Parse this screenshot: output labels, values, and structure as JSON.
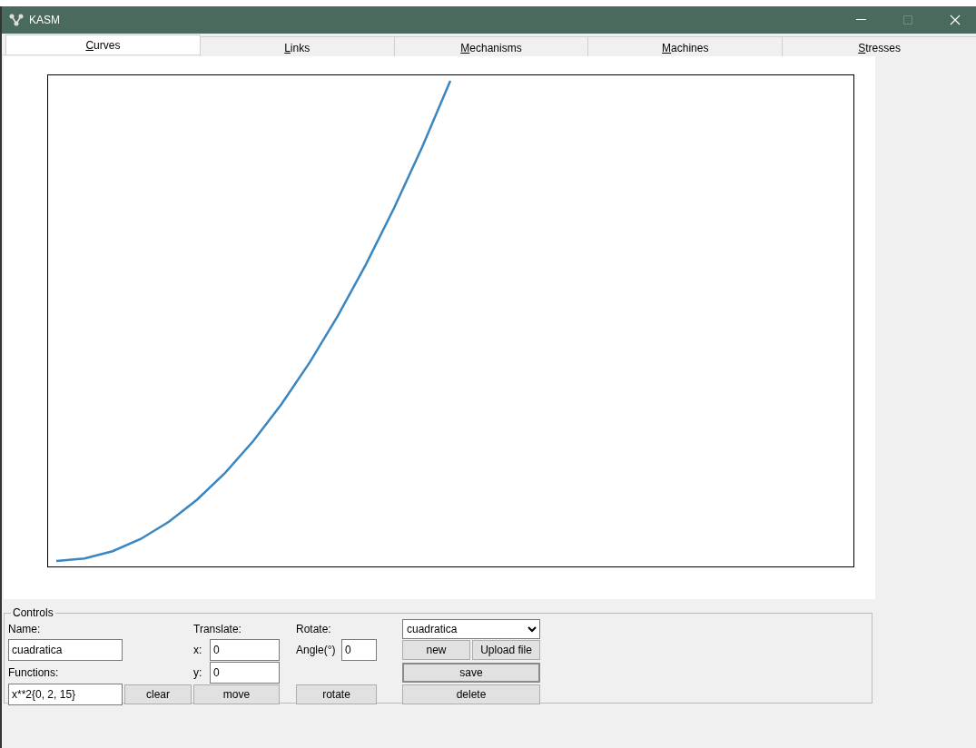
{
  "window": {
    "title": "KASM"
  },
  "tabs": [
    {
      "label": "Curves",
      "selected": true
    },
    {
      "label": "Links",
      "selected": false
    },
    {
      "label": "Mechanisms",
      "selected": false
    },
    {
      "label": "Machines",
      "selected": false
    },
    {
      "label": "Stresses",
      "selected": false
    }
  ],
  "controls": {
    "title": "Controls",
    "name_label": "Name:",
    "name_value": "cuadratica",
    "functions_label": "Functions:",
    "functions_value": "x**2{0, 2, 15}",
    "clear_button": "clear",
    "translate_label": "Translate:",
    "x_label": "x:",
    "x_value": "0",
    "y_label": "y:",
    "y_value": "0",
    "move_button": "move",
    "rotate_label": "Rotate:",
    "angle_label": "Angle(°)",
    "angle_value": "0",
    "rotate_button": "rotate",
    "curve_select": "cuadratica",
    "new_button": "new",
    "upload_button": "Upload file",
    "save_button": "save",
    "delete_button": "delete"
  }
}
